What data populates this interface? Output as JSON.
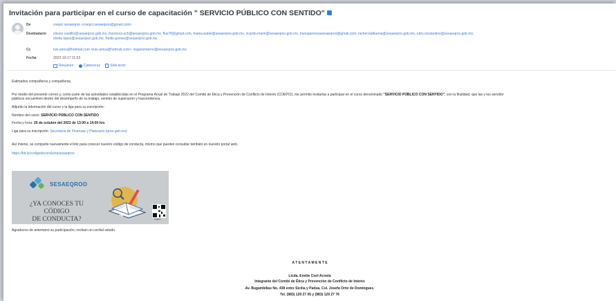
{
  "email": {
    "subject": "Invitación para participar en el curso de capacitación \" SERVICIO PÚBLICO CON SENTIDO\"",
    "header": {
      "from_label": "De",
      "from_value": "coepci sesaeqroo <coepci.sesaeqroo@gmail.com>",
      "to_label": "Destinatario",
      "to_line1": "eliezer.castillo@sesaeqroo.gob.mx, francisco.uch@sesaeqroo.gob.mx, flus78@gmail.com, maria.isabel@sesaeqroo.gob.mx, ricardo.marin@sesaeqroo.gob.mx, transparenciasesaeqroo@gmail.com, rachel.balbuena@sesaeqroo.gob.mx, rubi.constantino@sesaeqroo.gob.mx,",
      "to_line2": "sheila.lopez@sesaeqroo.gob.mx, fredie.gomez@sesaeqroo.gob.mx",
      "cc_label": "Cc",
      "cc_value": "luis.anica@hotmail.com <luis.anica@hotmail.com>, organointerno@sesaeqroo.gob.mx",
      "date_label": "Fecha",
      "date_value": "2022-10-17 11:53",
      "actions": [
        "Resumen",
        "Cabeceras",
        "Sólo texto"
      ]
    },
    "body": {
      "greeting": "Estimados compañeros y compañeras,",
      "p1_pre": " Por medio del presente correo y, como parte de las actividades establecidas en el Programa Anual de Trabajo 2022 del Comité de Ética y Prevención de Conflicto de Interés (COEPCI), me permito invitarlas a participar en el curso denominado ",
      "p1_bold": "\"SERVICIO PÚBLICO CON SENTIDO\"",
      "p1_post": ", con la finalidad, que las y los servidor",
      "p1_line2": "públicos encuentren dentro del desempeño de su trabajo, sentido de superación y trascendencia.",
      "adj": "Adjunto la información del curso y la liga para su inscripción:",
      "course_label": "Nombre del curso: ",
      "course_value": "SERVICIO PÚBLICO CON SENTIDO",
      "date_label": "Fecha y hora: ",
      "date_value": "25 de octubre del 2022 de 13:00 a 14:00 hrs",
      "liga_label": "Liga para su inscripción: ",
      "liga_value": "Secretaría de Finanzas y Planeació (qroo.gob.mx)",
      "p2": "Así mismo, se comparte nuevamente el link para conocer nuestro código de conducta, mismo que pueden consultar también en nuestro portal web.",
      "url": "https://bit.ly/codigodeconductasesaeqroo",
      "thanks": "Agradezco de antemano su participación, reciban un cordial saludo."
    },
    "banner": {
      "logo": "SESAEQROO",
      "question": "¿YA CONOCES TU CÓDIGO\nDE CONDUCTA?",
      "qr_caption": "COEPCI"
    },
    "signature": {
      "closing": "A T E N T A M E N T E",
      "name": "Licda. Evette Cool Acosta",
      "role": "Integrante del Comité de Ética y Prevención de Conflicto de Interés",
      "address": "Av. Bugambilias No. 438 entre Sicilia y Padua, Col. Josefa Ortiz de Domínguez.",
      "phone": "Tel. (983) 129 27 05 y (983) 129 27 76"
    }
  },
  "colors": {
    "link": "#3a7bd5",
    "text": "#333333",
    "brand": "#2d6fa8"
  },
  "icons": [
    "person-avatar-icon",
    "external-link-icon",
    "envelope-icon",
    "info-icon",
    "text-doc-icon",
    "qr-code-icon",
    "book-icon"
  ]
}
